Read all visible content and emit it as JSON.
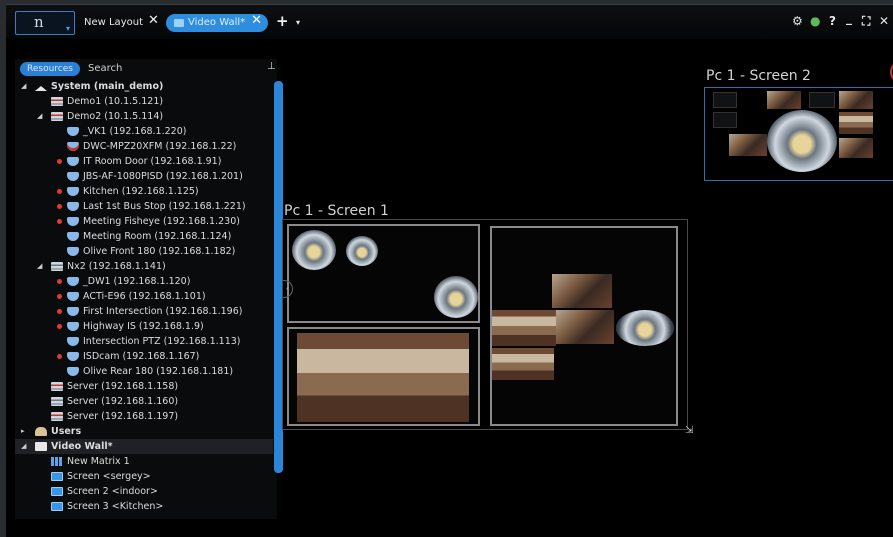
{
  "app": {
    "logo_text": "n",
    "tabs": [
      {
        "label": "New Layout",
        "active": false
      },
      {
        "label": "Video Wall*",
        "active": true
      }
    ],
    "add_tab": "+",
    "tab_menu": "▾",
    "window_controls": {
      "settings": "⚙",
      "shield": "●",
      "help": "?",
      "minimize": "_",
      "fullscreen": "⛶",
      "close": "✕"
    }
  },
  "panel": {
    "tab_resources": "Resources",
    "tab_search": "Search",
    "pin": "⊥",
    "tree": [
      {
        "label": "System (main_demo)",
        "level": 0,
        "icon": "home",
        "arrow": "◢",
        "dot": false
      },
      {
        "label": "Demo1 (10.1.5.121)",
        "level": 1,
        "icon": "server-red",
        "arrow": "",
        "dot": false
      },
      {
        "label": "Demo2 (10.1.5.114)",
        "level": 1,
        "icon": "server-red",
        "arrow": "◢",
        "dot": false
      },
      {
        "label": "_VK1 (192.168.1.220)",
        "level": 2,
        "icon": "cam",
        "dot": false
      },
      {
        "label": "DWC-MPZ20XFM (192.168.1.22)",
        "level": 2,
        "icon": "cam-red",
        "dot": false
      },
      {
        "label": "IT Room Door (192.168.1.91)",
        "level": 2,
        "icon": "cam",
        "dot": true
      },
      {
        "label": "JBS-AF-1080PISD (192.168.1.201)",
        "level": 2,
        "icon": "cam",
        "dot": false
      },
      {
        "label": "Kitchen (192.168.1.125)",
        "level": 2,
        "icon": "cam",
        "dot": true
      },
      {
        "label": "Last 1st Bus Stop (192.168.1.221)",
        "level": 2,
        "icon": "cam",
        "dot": true
      },
      {
        "label": "Meeting Fisheye (192.168.1.230)",
        "level": 2,
        "icon": "cam",
        "dot": true
      },
      {
        "label": "Meeting Room (192.168.1.124)",
        "level": 2,
        "icon": "cam",
        "dot": false
      },
      {
        "label": "Olive Front 180 (192.168.1.182)",
        "level": 2,
        "icon": "cam",
        "dot": false
      },
      {
        "label": "Nx2 (192.168.1.141)",
        "level": 1,
        "icon": "server",
        "arrow": "◢",
        "dot": false
      },
      {
        "label": "_DW1 (192.168.1.120)",
        "level": 2,
        "icon": "cam",
        "dot": true
      },
      {
        "label": "ACTi-E96 (192.168.1.101)",
        "level": 2,
        "icon": "cam",
        "dot": true
      },
      {
        "label": "First Intersection (192.168.1.196)",
        "level": 2,
        "icon": "cam",
        "dot": true
      },
      {
        "label": "Highway IS (192.168.1.9)",
        "level": 2,
        "icon": "cam",
        "dot": true
      },
      {
        "label": "Intersection PTZ (192.168.1.113)",
        "level": 2,
        "icon": "cam",
        "dot": false
      },
      {
        "label": "ISDcam (192.168.1.167)",
        "level": 2,
        "icon": "cam",
        "dot": true
      },
      {
        "label": "Olive Rear 180 (192.168.1.181)",
        "level": 2,
        "icon": "cam",
        "dot": false
      },
      {
        "label": "Server (192.168.1.158)",
        "level": 1,
        "icon": "server-red",
        "dot": false
      },
      {
        "label": "Server (192.168.1.160)",
        "level": 1,
        "icon": "server",
        "dot": false
      },
      {
        "label": "Server (192.168.1.197)",
        "level": 1,
        "icon": "server-red",
        "dot": false
      },
      {
        "label": "Users",
        "level": 0,
        "icon": "users",
        "arrow": "▸",
        "dot": false
      },
      {
        "label": "Video Wall*",
        "level": 0,
        "icon": "vw",
        "arrow": "◢",
        "dot": false,
        "selected": true
      },
      {
        "label": "New Matrix 1",
        "level": 1,
        "icon": "matrix",
        "dot": false
      },
      {
        "label": "Screen <sergey>",
        "level": 1,
        "icon": "screen",
        "dot": false
      },
      {
        "label": "Screen 2 <indoor>",
        "level": 1,
        "icon": "screen",
        "dot": false
      },
      {
        "label": "Screen 3 <Kitchen>",
        "level": 1,
        "icon": "screen",
        "dot": false
      }
    ]
  },
  "canvas": {
    "screen1_label": "Pc 1 - Screen 1",
    "screen2_label": "Pc 1 - Screen 2"
  },
  "colors": {
    "accent": "#2f8de0",
    "alert_dot": "#e23b2e",
    "background": "#000000"
  }
}
